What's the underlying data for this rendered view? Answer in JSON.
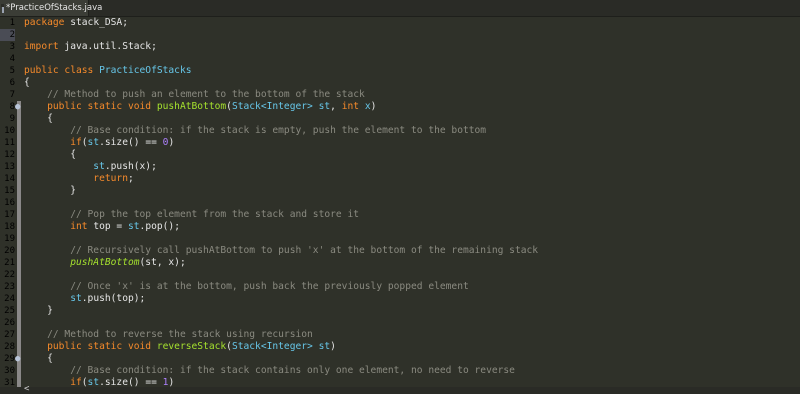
{
  "tab": {
    "label": "*PracticeOfStacks.java"
  },
  "line_numbers": [
    "1",
    "2",
    "3",
    "4",
    "5",
    "6",
    "7",
    "8",
    "9",
    "10",
    "11",
    "12",
    "13",
    "14",
    "15",
    "16",
    "17",
    "18",
    "19",
    "20",
    "21",
    "22",
    "23",
    "24",
    "25",
    "26",
    "27",
    "28",
    "29",
    "30",
    "31"
  ],
  "code": {
    "l1_kw": "package",
    "l1_rest": " stack_DSA;",
    "l3_kw": "import",
    "l3_rest": " java.util.Stack;",
    "l5_kw": "public class",
    "l5_cls": " PracticeOfStacks",
    "l6": "{",
    "l7": "    // Method to push an element to the bottom of the stack",
    "l8_kw": "    public static void",
    "l8_fn": " pushAtBottom",
    "l8_p1": "(",
    "l8_ty": "Stack<Integer>",
    "l8_var": " st",
    "l8_p2": ", ",
    "l8_kw2": "int",
    "l8_var2": " x",
    "l8_p3": ")",
    "l9": "    {",
    "l10": "        // Base condition: if the stack is empty, push the element to the bottom",
    "l11_kw": "        if",
    "l11_p1": "(",
    "l11_var": "st",
    "l11_p2": ".size() == ",
    "l11_num": "0",
    "l11_p3": ")",
    "l12": "        {",
    "l13_var": "            st",
    "l13_rest": ".push(x);",
    "l14_kw": "            return",
    "l14_rest": ";",
    "l15": "        }",
    "l17": "        // Pop the top element from the stack and store it",
    "l18_kw": "        int",
    "l18_rest": " top = ",
    "l18_var": "st",
    "l18_rest2": ".pop();",
    "l20": "        // Recursively call pushAtBottom to push 'x' at the bottom of the remaining stack",
    "l21_fn": "        pushAtBottom",
    "l21_rest": "(st, x);",
    "l23": "        // Once 'x' is at the bottom, push back the previously popped element",
    "l24_var": "        st",
    "l24_rest": ".push(top);",
    "l25": "    }",
    "l27": "    // Method to reverse the stack using recursion",
    "l28_kw": "    public static void",
    "l28_fn": " reverseStack",
    "l28_p1": "(",
    "l28_ty": "Stack<Integer>",
    "l28_var": " st",
    "l28_p2": ")",
    "l29": "    {",
    "l30": "        // Base condition: if the stack contains only one element, no need to reverse",
    "l31_kw": "        if",
    "l31_p1": "(",
    "l31_var": "st",
    "l31_p2": ".size() == ",
    "l31_num": "1",
    "l31_p3": ")"
  },
  "scroll": {
    "left_arrow": "<"
  },
  "icons": {
    "tab": "java-file-icon",
    "override": "override-marker-icon"
  },
  "colors": {
    "background": "#2f3129",
    "keyword": "#f58a2b",
    "comment": "#8a8a80",
    "method": "#a6e22e",
    "type": "#67c6e8",
    "number": "#ae81ff"
  }
}
